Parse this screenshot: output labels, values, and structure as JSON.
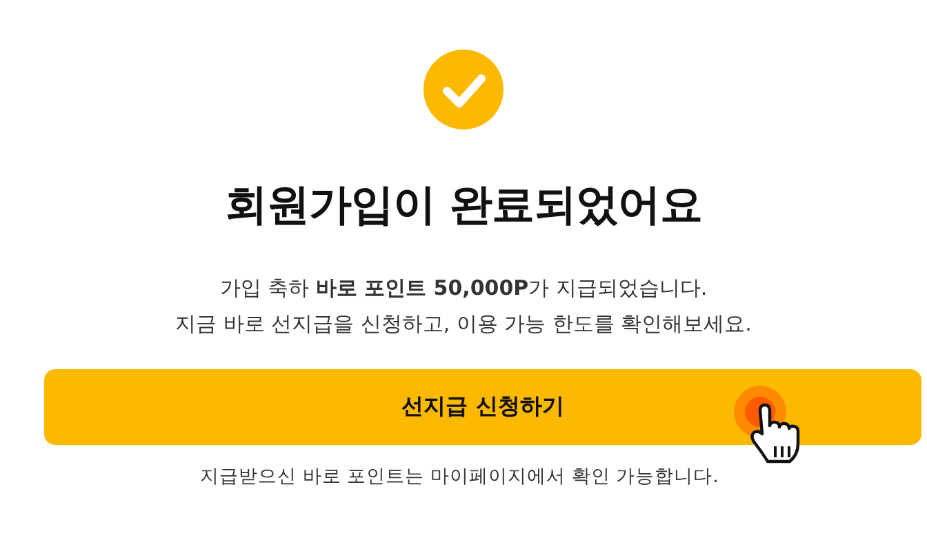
{
  "title": "회원가입이 완료되었어요",
  "message": [
    "가입 축하 **바로 포인트 50,000P**가 지급되었습니다.",
    "지금 바로 선지급을 신청하고, 이용 가능 한도를 확인해보세요."
  ],
  "button": {
    "label": "선지급 신청하기"
  },
  "footnote": "지급받으신 바로 포인트는 마이페이지에서 확인 가능합니다."
}
